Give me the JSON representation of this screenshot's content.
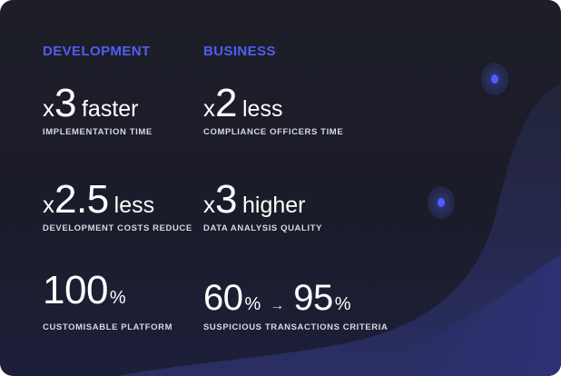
{
  "columns": {
    "development": {
      "heading": "DEVELOPMENT",
      "items": [
        {
          "prefix": "x",
          "value": "3",
          "suffix": "faster",
          "caption": "IMPLEMENTATION TIME"
        },
        {
          "prefix": "x",
          "value": "2.5",
          "suffix": "less",
          "caption": "DEVELOPMENT COSTS REDUCE"
        },
        {
          "value": "100",
          "unit": "%",
          "caption": "CUSTOMISABLE PLATFORM"
        }
      ]
    },
    "business": {
      "heading": "BUSINESS",
      "items": [
        {
          "prefix": "x",
          "value": "2",
          "suffix": "less",
          "caption": "COMPLIANCE OFFICERS TIME"
        },
        {
          "prefix": "x",
          "value": "3",
          "suffix": "higher",
          "caption": "DATA ANALYSIS QUALITY"
        },
        {
          "from": "60",
          "from_unit": "%",
          "arrow": "→",
          "to": "95",
          "to_unit": "%",
          "caption": "SUSPICIOUS TRANSACTIONS CRITERIA"
        }
      ]
    }
  },
  "colors": {
    "accent": "#4f5ef5",
    "background": "#1d1e27",
    "text": "#ffffff"
  }
}
